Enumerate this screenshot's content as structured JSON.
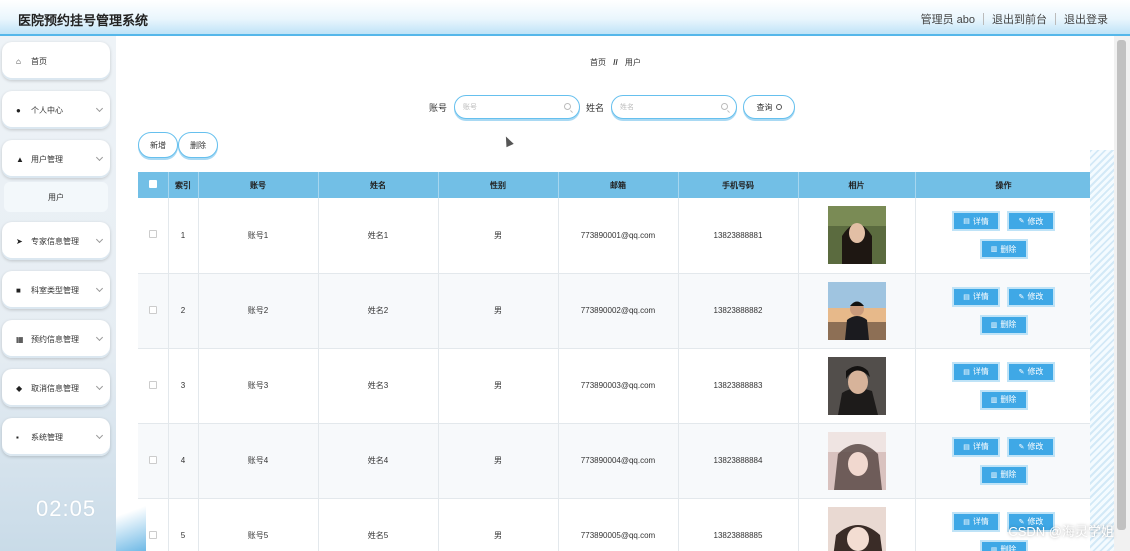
{
  "header": {
    "title": "医院预约挂号管理系统",
    "user_label": "管理员 abo",
    "to_front": "退出到前台",
    "logout": "退出登录"
  },
  "sidebar": {
    "items": [
      {
        "label": "首页",
        "icon": "home-icon",
        "glyph": "⌂"
      },
      {
        "label": "个人中心",
        "icon": "user-icon",
        "glyph": "●"
      },
      {
        "label": "用户管理",
        "icon": "thumbs-up-icon",
        "glyph": "▲"
      },
      {
        "label": "专家信息管理",
        "icon": "send-icon",
        "glyph": "➤"
      },
      {
        "label": "科室类型管理",
        "icon": "monitor-icon",
        "glyph": "■"
      },
      {
        "label": "预约信息管理",
        "icon": "grid-icon",
        "glyph": "▦"
      },
      {
        "label": "取消信息管理",
        "icon": "pin-icon",
        "glyph": "◆"
      },
      {
        "label": "系统管理",
        "icon": "apps-icon",
        "glyph": "▪"
      }
    ],
    "sub_item": "用户",
    "clock": "02:05"
  },
  "breadcrumb": {
    "home": "首页",
    "sep": "//",
    "current": "用户"
  },
  "search": {
    "account_label": "账号",
    "account_placeholder": "账号",
    "name_label": "姓名",
    "name_placeholder": "姓名",
    "query_button": "查询"
  },
  "actions": {
    "add": "新增",
    "delete": "删除"
  },
  "table": {
    "headers": [
      "",
      "索引",
      "账号",
      "姓名",
      "性别",
      "邮箱",
      "手机号码",
      "相片",
      "操作"
    ],
    "rows": [
      {
        "index": "1",
        "account": "账号1",
        "name": "姓名1",
        "gender": "男",
        "email": "773890001@qq.com",
        "phone": "13823888881"
      },
      {
        "index": "2",
        "account": "账号2",
        "name": "姓名2",
        "gender": "男",
        "email": "773890002@qq.com",
        "phone": "13823888882"
      },
      {
        "index": "3",
        "account": "账号3",
        "name": "姓名3",
        "gender": "男",
        "email": "773890003@qq.com",
        "phone": "13823888883"
      },
      {
        "index": "4",
        "account": "账号4",
        "name": "姓名4",
        "gender": "男",
        "email": "773890004@qq.com",
        "phone": "13823888884"
      },
      {
        "index": "5",
        "account": "账号5",
        "name": "姓名5",
        "gender": "男",
        "email": "773890005@qq.com",
        "phone": "13823888885"
      }
    ],
    "op_detail": "详情",
    "op_edit": "修改",
    "op_delete": "删除"
  },
  "colors": {
    "accent": "#3fa8e6",
    "header_blue": "#72bfe6"
  },
  "watermark": "CSDN @海灵学姐"
}
